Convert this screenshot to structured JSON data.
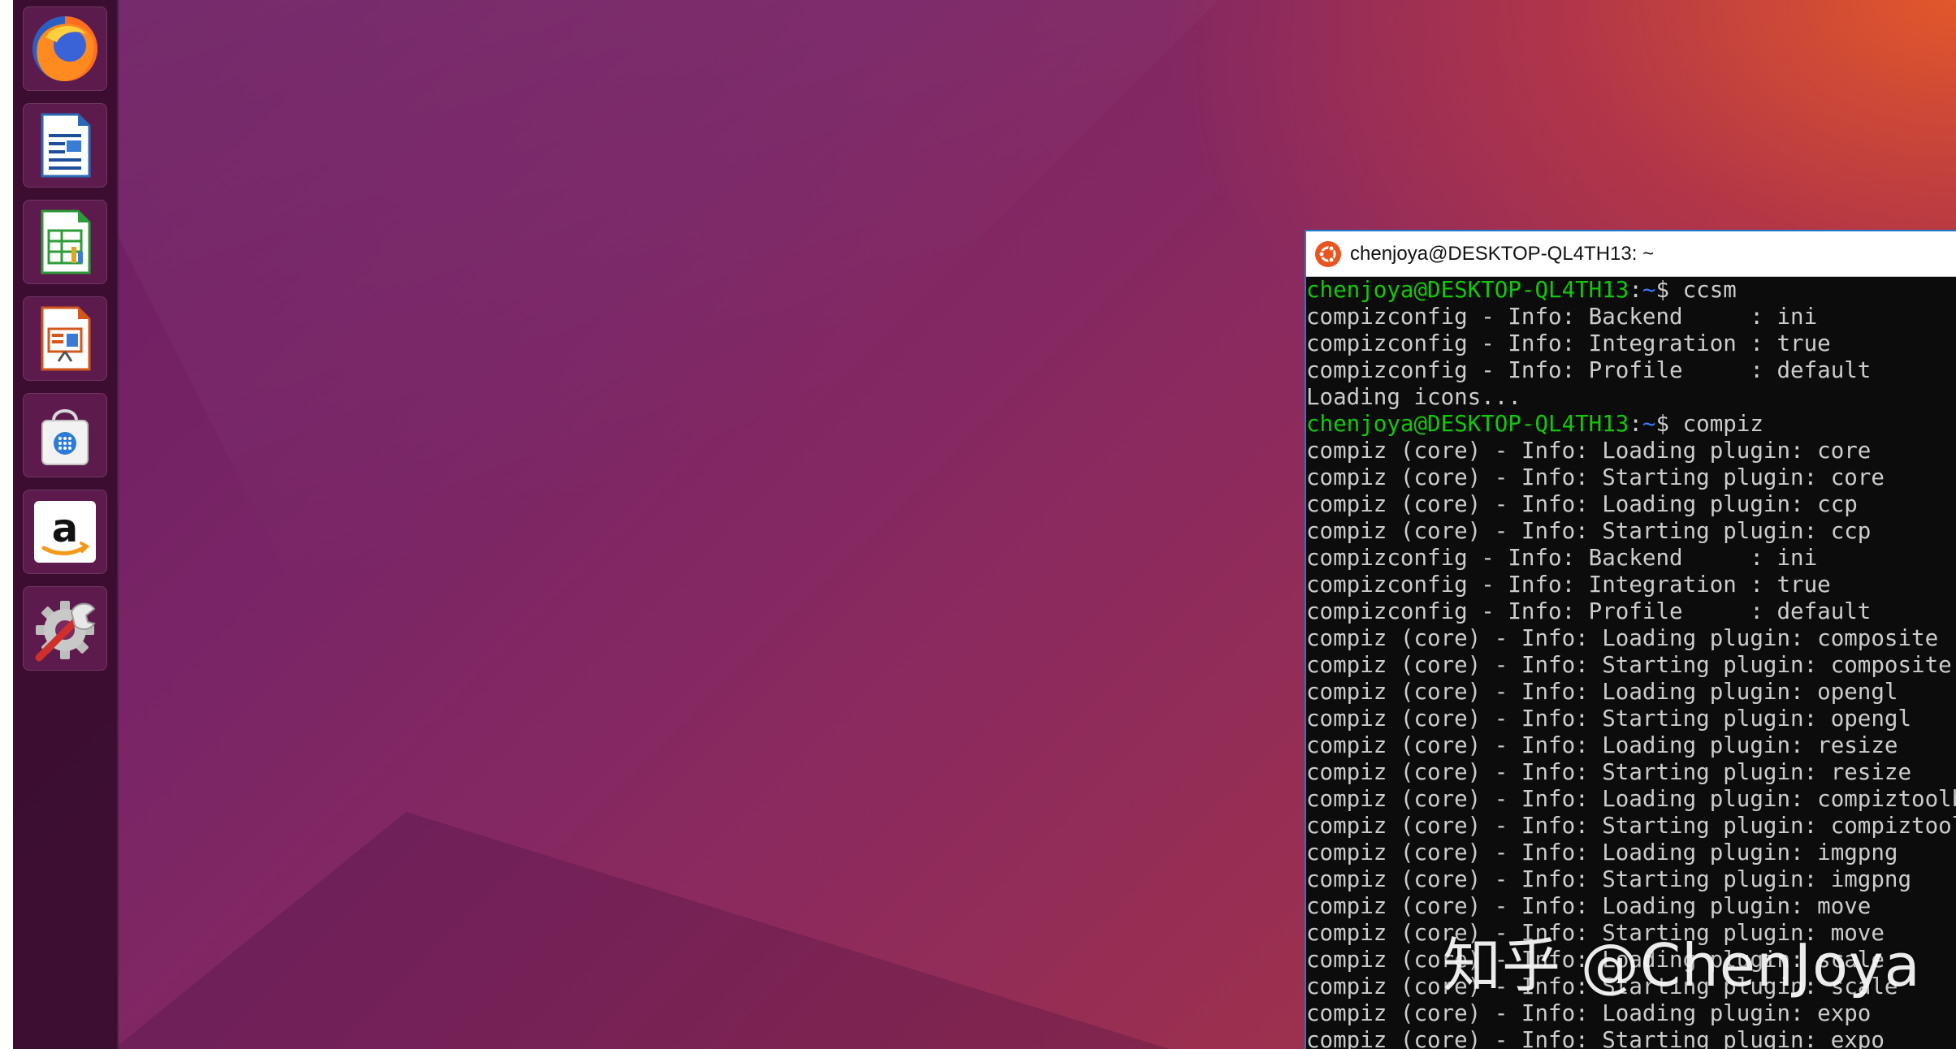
{
  "launcher": {
    "items": [
      {
        "name": "firefox"
      },
      {
        "name": "libreoffice-writer"
      },
      {
        "name": "libreoffice-calc"
      },
      {
        "name": "libreoffice-impress"
      },
      {
        "name": "ubuntu-software"
      },
      {
        "name": "amazon"
      },
      {
        "name": "system-settings"
      }
    ]
  },
  "terminal": {
    "title": "chenjoya@DESKTOP-QL4TH13: ~",
    "prompt_user": "chenjoya@DESKTOP-QL4TH13",
    "prompt_path": "~",
    "commands": [
      "ccsm",
      "compiz"
    ],
    "lines_block1": [
      "compizconfig - Info: Backend     : ini",
      "compizconfig - Info: Integration : true",
      "compizconfig - Info: Profile     : default",
      "Loading icons..."
    ],
    "lines_block2": [
      "compiz (core) - Info: Loading plugin: core",
      "compiz (core) - Info: Starting plugin: core",
      "compiz (core) - Info: Loading plugin: ccp",
      "compiz (core) - Info: Starting plugin: ccp",
      "compizconfig - Info: Backend     : ini",
      "compizconfig - Info: Integration : true",
      "compizconfig - Info: Profile     : default",
      "compiz (core) - Info: Loading plugin: composite",
      "compiz (core) - Info: Starting plugin: composite",
      "compiz (core) - Info: Loading plugin: opengl",
      "compiz (core) - Info: Starting plugin: opengl",
      "compiz (core) - Info: Loading plugin: resize",
      "compiz (core) - Info: Starting plugin: resize",
      "compiz (core) - Info: Loading plugin: compiztoolbox",
      "compiz (core) - Info: Starting plugin: compiztoolbox",
      "compiz (core) - Info: Loading plugin: imgpng",
      "compiz (core) - Info: Starting plugin: imgpng",
      "compiz (core) - Info: Loading plugin: move",
      "compiz (core) - Info: Starting plugin: move",
      "compiz (core) - Info: Loading plugin: scale",
      "compiz (core) - Info: Starting plugin: scale",
      "compiz (core) - Info: Loading plugin: expo",
      "compiz (core) - Info: Starting plugin: expo"
    ]
  },
  "watermark": "知乎 @ChenJoya",
  "colors": {
    "prompt_user": "#16c60c",
    "prompt_path": "#3b78ff",
    "terminal_bg": "#0c0c0c",
    "terminal_text": "#cccccc"
  }
}
